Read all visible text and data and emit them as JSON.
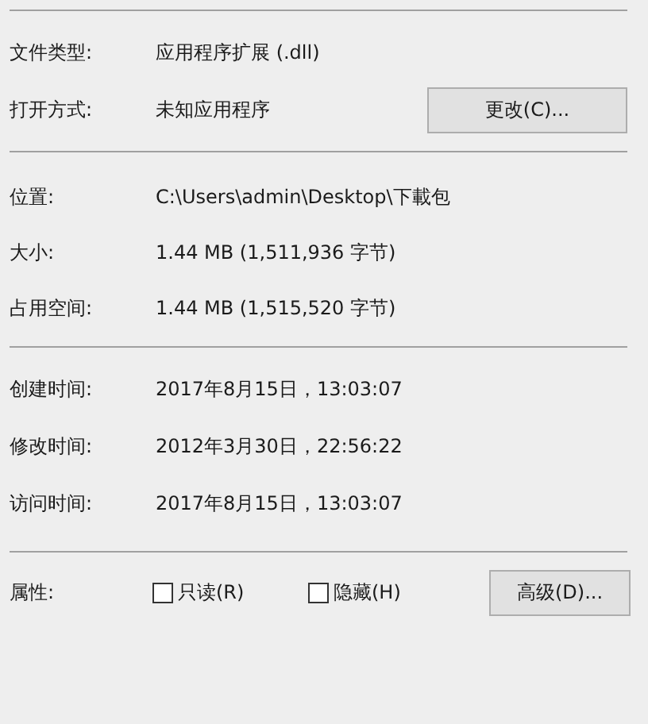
{
  "sections": [
    {
      "rows": [
        {
          "label": "文件类型:",
          "value": "应用程序扩展 (.dll)"
        },
        {
          "label": "打开方式:",
          "value": "未知应用程序",
          "button": "更改(C)..."
        }
      ]
    },
    {
      "rows": [
        {
          "label": "位置:",
          "value": "C:\\Users\\admin\\Desktop\\下載包"
        },
        {
          "label": "大小:",
          "value": "1.44 MB (1,511,936 字节)"
        },
        {
          "label": "占用空间:",
          "value": "1.44 MB (1,515,520 字节)"
        }
      ]
    },
    {
      "rows": [
        {
          "label": "创建时间:",
          "value": "2017年8月15日，13:03:07"
        },
        {
          "label": "修改时间:",
          "value": "2012年3月30日，22:56:22"
        },
        {
          "label": "访问时间:",
          "value": "2017年8月15日，13:03:07"
        }
      ]
    }
  ],
  "attributes": {
    "label": "属性:",
    "checkboxes": [
      {
        "label": "只读(R)",
        "checked": false
      },
      {
        "label": "隐藏(H)",
        "checked": false
      }
    ],
    "button": "高级(D)..."
  }
}
